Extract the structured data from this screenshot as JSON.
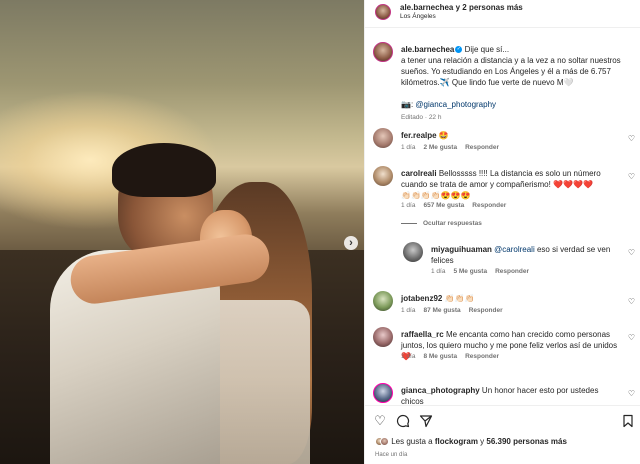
{
  "header": {
    "username": "ale.barnechea",
    "collab_suffix": "y 2 personas más",
    "location": "Los Ángeles"
  },
  "caption": {
    "username": "ale.barnechea",
    "line1": "Dije que sí...",
    "line2": "a tener una relación a distancia y a la vez a no soltar nuestros",
    "line3": "sueños. Yo estudiando en Los Ángeles y él a más de 6.757",
    "line4": "kilómetros.✈️ Que lindo fue verte de nuevo M🤍",
    "camera_prefix": "📷: ",
    "credit": "@gianca_photography",
    "edited": "Editado · 22 h"
  },
  "comments": [
    {
      "user": "fer.realpe",
      "text": "🤩",
      "time": "1 día",
      "likes": "2 Me gusta",
      "reply": "Responder"
    },
    {
      "user": "carolreali",
      "text_l1": "Bellosssss !!!! La distancia es solo un número",
      "text_l2": "cuando se trata de amor y compañerismo! ❤️❤️❤️❤️",
      "text_l3": "👏🏻👏🏻👏🏻👏🏻😍😍😍",
      "time": "1 día",
      "likes": "657 Me gusta",
      "reply": "Responder",
      "hide_replies": "Ocultar respuestas"
    },
    {
      "user": "miyaguihuaman",
      "mention": "@carolreali",
      "text_l1": " eso si verdad se ven",
      "text_l2": "felices",
      "time": "1 día",
      "likes": "5 Me gusta",
      "reply": "Responder"
    },
    {
      "user": "jotabenz92",
      "text": "👏🏻👏🏻👏🏻",
      "time": "1 día",
      "likes": "87 Me gusta",
      "reply": "Responder"
    },
    {
      "user": "raffaella_rc",
      "text_l1": "Me encanta como han crecido como personas",
      "text_l2": "juntos, los quiero mucho y me pone feliz verlos así de unidos",
      "text_l3": "❤️",
      "time": "1 día",
      "likes": "8 Me gusta",
      "reply": "Responder"
    },
    {
      "user": "gianca_photography",
      "text_l1": "Un honor hacer esto por ustedes chicos",
      "text_l2": "📷❤️"
    }
  ],
  "likes": {
    "prefix": "Les gusta a ",
    "user": "flockogram",
    "middle": " y ",
    "count": "56.390 personas más"
  },
  "time_ago": "Hace un día",
  "icons": {
    "heart": "heart-icon",
    "comment": "comment-icon",
    "share": "share-icon",
    "save": "bookmark-icon",
    "next": "chevron-right-icon"
  }
}
